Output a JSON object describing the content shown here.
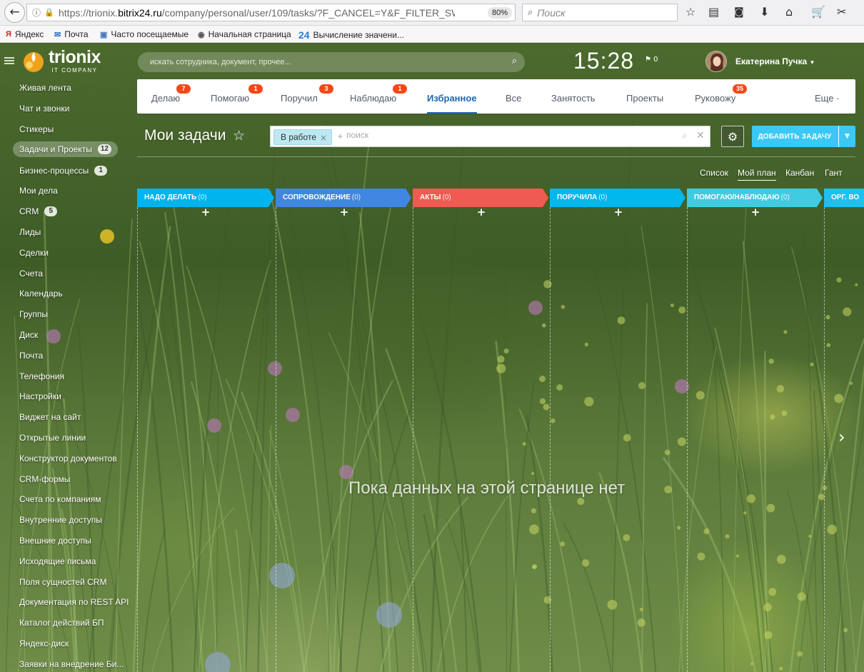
{
  "browser": {
    "url_host": "https://trionix.",
    "url_domain": "bitrix24.ru",
    "url_path": "/company/personal/user/109/tasks/?F_CANCEL=Y&F_FILTER_SW",
    "zoom": "80%",
    "search_placeholder": "Поиск",
    "bookmarks": [
      "Яндекс",
      "Почта",
      "Часто посещаемые",
      "Начальная страница",
      "Вычисление значени..."
    ]
  },
  "portal": {
    "logo_name": "trionix",
    "logo_tagline": "IT COMPANY",
    "search_placeholder": "искать сотрудника, документ, прочее...",
    "time": "15:28",
    "flag_count": "0",
    "user_name": "Екатерина Пучка"
  },
  "sidebar": {
    "items": [
      {
        "label": "Живая лента"
      },
      {
        "label": "Чат и звонки"
      },
      {
        "label": "Стикеры"
      },
      {
        "label": "Задачи и Проекты",
        "count": "12",
        "active": true
      },
      {
        "label": "Бизнес-процессы",
        "count": "1"
      },
      {
        "label": "Мои дела"
      },
      {
        "label": "CRM",
        "count": "5"
      },
      {
        "label": "Лиды"
      },
      {
        "label": "Сделки"
      },
      {
        "label": "Счета"
      },
      {
        "label": "Календарь"
      },
      {
        "label": "Группы"
      },
      {
        "label": "Диск"
      },
      {
        "label": "Почта"
      },
      {
        "label": "Телефония"
      },
      {
        "label": "Настройки"
      },
      {
        "label": "Виджет на сайт"
      },
      {
        "label": "Открытые линии"
      },
      {
        "label": "Конструктор документов"
      },
      {
        "label": "CRM-формы"
      },
      {
        "label": "Счета по компаниям"
      },
      {
        "label": "Внутренние доступы"
      },
      {
        "label": "Внешние доступы"
      },
      {
        "label": "Исходящие письма"
      },
      {
        "label": "Поля сущностей CRM"
      },
      {
        "label": "Документация по REST API"
      },
      {
        "label": "Каталог действий БП"
      },
      {
        "label": "Яндекс-диск"
      },
      {
        "label": "Заявки на внедрение Би..."
      }
    ]
  },
  "tabs": [
    {
      "label": "Делаю",
      "badge": "7"
    },
    {
      "label": "Помогаю",
      "badge": "1"
    },
    {
      "label": "Поручил",
      "badge": "3"
    },
    {
      "label": "Наблюдаю",
      "badge": "1"
    },
    {
      "label": "Избранное",
      "active": true
    },
    {
      "label": "Все"
    },
    {
      "label": "Занятость"
    },
    {
      "label": "Проекты"
    },
    {
      "label": "Руковожу",
      "badge": "35"
    },
    {
      "label": "Еще ·"
    }
  ],
  "page": {
    "title": "Мои задачи",
    "filter_chip": "В работе",
    "filter_placeholder": "поиск",
    "add_button": "ДОБАВИТЬ ЗАДАЧУ",
    "views": [
      "Список",
      "Мой план",
      "Канбан",
      "Гант"
    ],
    "active_view": "Мой план",
    "empty_message": "Пока данных на этой странице нет"
  },
  "kanban": {
    "columns": [
      {
        "title": "НАДО ДЕЛАТЬ",
        "count": "(0)",
        "color": "#00b4f0"
      },
      {
        "title": "СОПРОВОЖДЕНИЕ",
        "count": "(0)",
        "color": "#3f87e0"
      },
      {
        "title": "АКТЫ",
        "count": "(0)",
        "color": "#f05a52"
      },
      {
        "title": "ПОРУЧИЛА",
        "count": "(0)",
        "color": "#00b7ee"
      },
      {
        "title": "ПОМОГАЮ/НАБЛЮДАЮ",
        "count": "(0)",
        "color": "#40cbe0"
      },
      {
        "title": "ОРГ. ВО",
        "count": "",
        "color": "#1fbff0"
      }
    ]
  }
}
